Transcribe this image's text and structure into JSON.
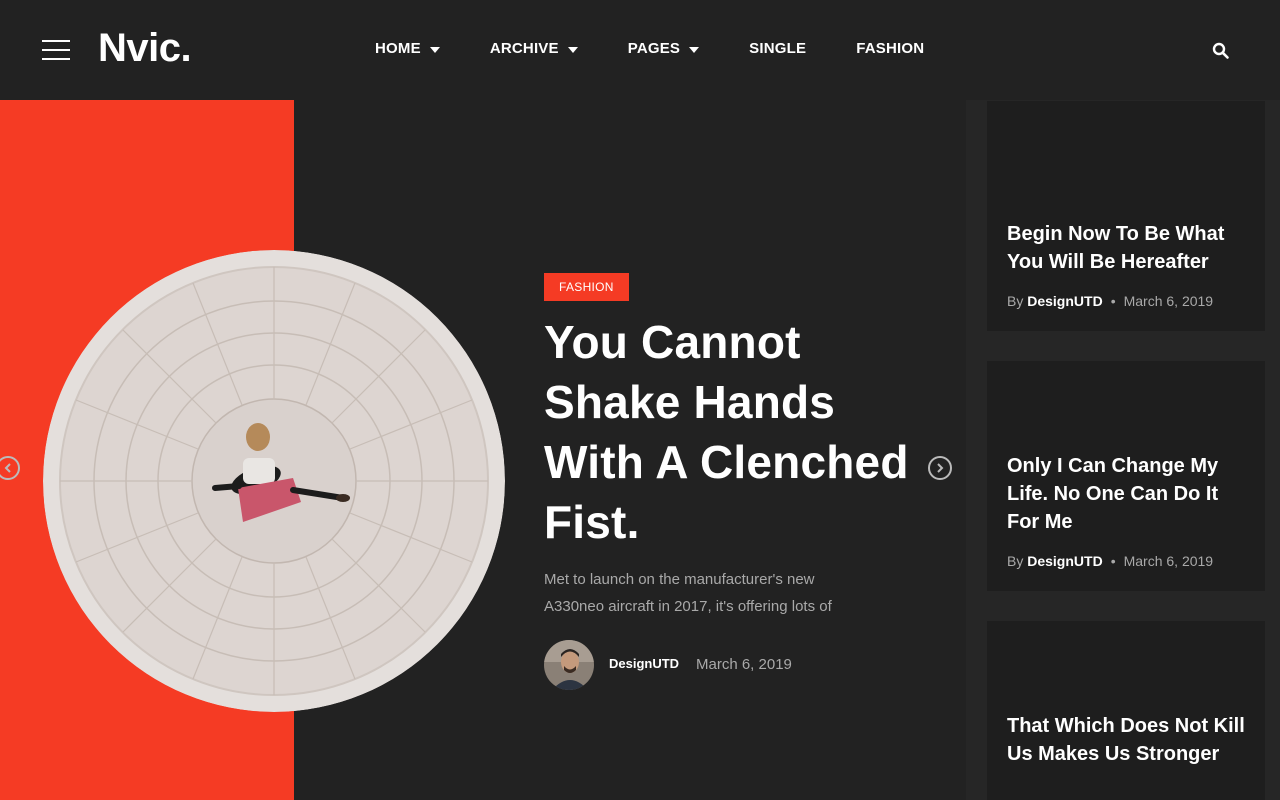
{
  "header": {
    "logo": "Nvic.",
    "nav": [
      {
        "label": "HOME",
        "has_dropdown": true
      },
      {
        "label": "ARCHIVE",
        "has_dropdown": true
      },
      {
        "label": "PAGES",
        "has_dropdown": true
      },
      {
        "label": "SINGLE",
        "has_dropdown": false
      },
      {
        "label": "FASHION",
        "has_dropdown": false
      }
    ],
    "icons": {
      "menu": "hamburger-menu-icon",
      "search": "search-icon"
    }
  },
  "hero": {
    "category": "FASHION",
    "title": "You Cannot Shake Hands With A Clenched Fist.",
    "excerpt": "Met to launch on the manufacturer's new A330neo aircraft in 2017, it's offering lots of",
    "author": "DesignUTD",
    "date": "March 6, 2019",
    "prev_icon": "chevron-left-circle-icon",
    "next_icon": "chevron-right-circle-icon"
  },
  "sidebar": {
    "posts": [
      {
        "title": "Begin Now To Be What You Will Be Hereafter",
        "by": "By",
        "author": "DesignUTD",
        "date": "March 6, 2019"
      },
      {
        "title": "Only I Can Change My Life. No One Can Do It For Me",
        "by": "By",
        "author": "DesignUTD",
        "date": "March 6, 2019"
      },
      {
        "title": "That Which Does Not Kill Us Makes Us Stronger"
      }
    ]
  },
  "colors": {
    "accent": "#f53b24",
    "background": "#222222",
    "card": "#1e1e1e",
    "muted_text": "#a9a9a9"
  }
}
